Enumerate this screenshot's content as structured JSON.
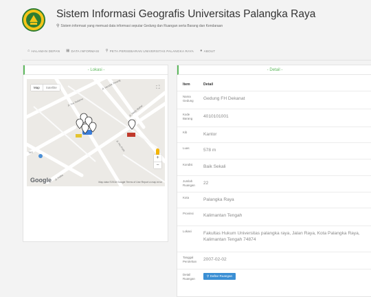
{
  "header": {
    "title": "Sistem Informasi Geografis Universitas Palangka Raya",
    "subtitle": "Sistem informasi yang memuat data informasi seputar Gedung dan Ruangan serta Barang dan Kendaraan",
    "colors": {
      "accent": "#5cb85c",
      "logo": "#2e7d32",
      "button": "#3b8fd4"
    }
  },
  "nav": {
    "items": [
      {
        "icon": "home-icon",
        "label": "HALAMAN DEPAN"
      },
      {
        "icon": "table-icon",
        "label": "DATA INFORMASI"
      },
      {
        "icon": "map-marker-icon",
        "label": "PETA PERSEBARAN UNIVERSITAS PALANGKA RAYA"
      },
      {
        "icon": "user-icon",
        "label": "ABOUT"
      }
    ]
  },
  "lokasi": {
    "title": "- Lokasi -",
    "map": {
      "type_options": [
        "Map",
        "Satellite"
      ],
      "selected_type": "Map",
      "labels": [
        "Jl. Yos Sudarso",
        "Jl. Hendrik Timang",
        "Jl. Hiu Putih",
        "Jl. Mahir Mahar",
        "TAS",
        "Jl. Pelita"
      ],
      "logo_text": "Google",
      "attribution": "Map data ©2018 Google   Terms of Use   Report a map error"
    }
  },
  "detail": {
    "title": "- Detail -",
    "col_item": "Item",
    "col_detail": "Detail",
    "rows": [
      {
        "item": "Nama Gedung",
        "value": "Gedung FH Dekanat"
      },
      {
        "item": "Kode Barang",
        "value": "4010101001"
      },
      {
        "item": "Kib",
        "value": "Kantor"
      },
      {
        "item": "Luas",
        "value": "578 m"
      },
      {
        "item": "Kondisi",
        "value": "Baik Sekali"
      },
      {
        "item": "Jumlah Ruangan",
        "value": "22"
      },
      {
        "item": "Kota",
        "value": "Palangka Raya"
      },
      {
        "item": "Provinsi",
        "value": "Kalimantan Tengah"
      },
      {
        "item": "Lokasi",
        "value": "Fakultas Hukum Universitas palangka raya, Jalan Raya, Kota Palangka Raya, Kalimantan Tengah 74874"
      },
      {
        "item": "Tanggal Perolehan",
        "value": "2007-02-02"
      }
    ],
    "last_item": "Detail Ruangan",
    "button_label": "Daftar Ruangan"
  }
}
